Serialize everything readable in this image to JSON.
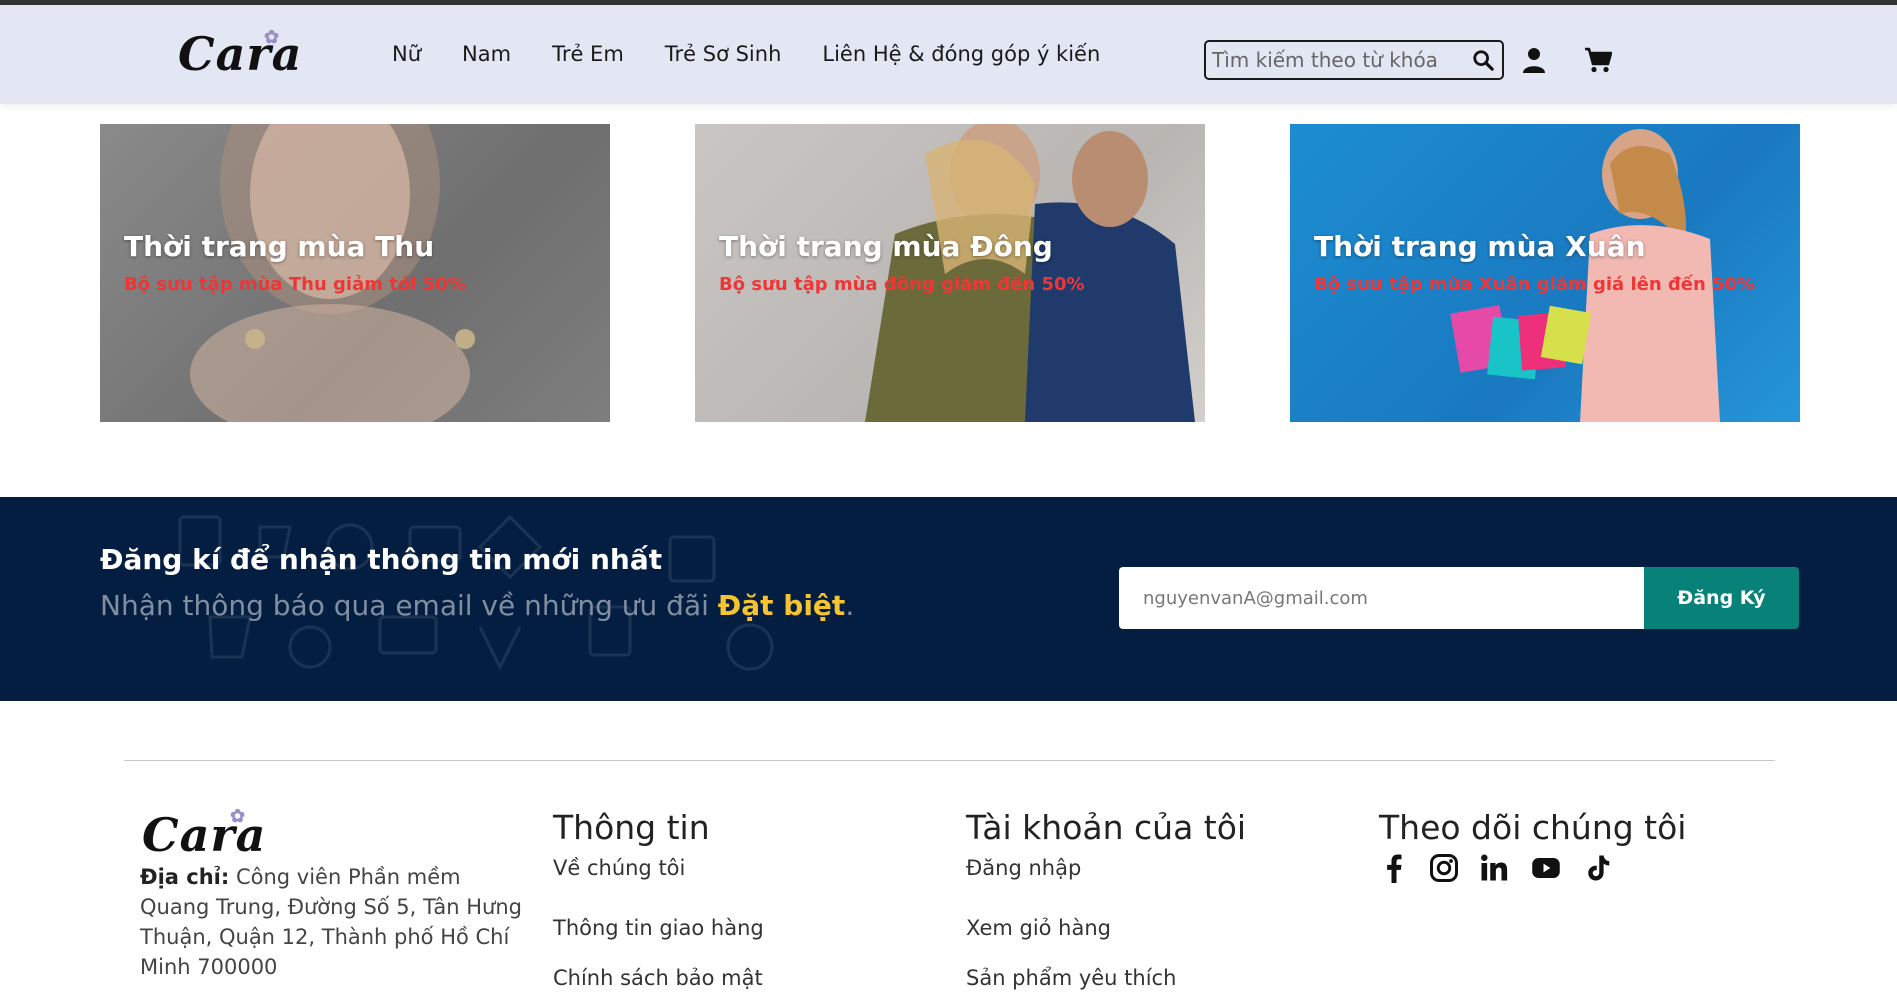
{
  "header": {
    "logo_text": "Cara",
    "nav": [
      "Nữ",
      "Nam",
      "Trẻ Em",
      "Trẻ Sơ Sinh",
      "Liên Hệ & đóng góp ý kiến"
    ],
    "search_placeholder": "Tìm kiếm theo từ khóa"
  },
  "banners": [
    {
      "title": "Thời trang mùa Thu",
      "subtitle": "Bộ sưu tập mùa Thu giảm tới 50%"
    },
    {
      "title": "Thời trang mùa Đông",
      "subtitle": "Bộ sưu tập mùa đông giảm đến 50%"
    },
    {
      "title": "Thời trang mùa Xuân",
      "subtitle": "Bộ sưu tập mùa Xuân giảm giá lên đến 50%"
    }
  ],
  "newsletter": {
    "title": "Đăng kí để nhận thông tin mới nhất",
    "subtitle_prefix": "Nhận thông báo qua email về những ưu đãi",
    "subtitle_highlight": "Đặt biệt",
    "subtitle_suffix": ".",
    "email_placeholder": "nguyenvanA@gmail.com",
    "button_label": "Đăng Ký"
  },
  "footer": {
    "logo_text": "Cara",
    "address_label": "Địa chỉ:",
    "address_text": "Công viên Phần mềm Quang Trung, Đường Số 5, Tân Hưng Thuận, Quận 12, Thành phố Hồ Chí Minh 700000",
    "columns": [
      {
        "title": "Thông tin",
        "links": [
          "Về chúng tôi",
          "Thông tin giao hàng",
          "Chính sách bảo mật"
        ]
      },
      {
        "title": "Tài khoản của tôi",
        "links": [
          "Đăng nhập",
          "Xem giỏ hàng",
          "Sản phẩm yêu thích"
        ]
      }
    ],
    "social_title": "Theo dõi chúng tôi",
    "social_icons": [
      "facebook-icon",
      "instagram-icon",
      "linkedin-icon",
      "youtube-icon",
      "tiktok-icon"
    ]
  },
  "colors": {
    "header_bg": "#e3e6f3",
    "newsletter_bg": "#041e42",
    "accent": "#088178",
    "highlight": "#f5c430",
    "sale_red": "#ef3636"
  }
}
